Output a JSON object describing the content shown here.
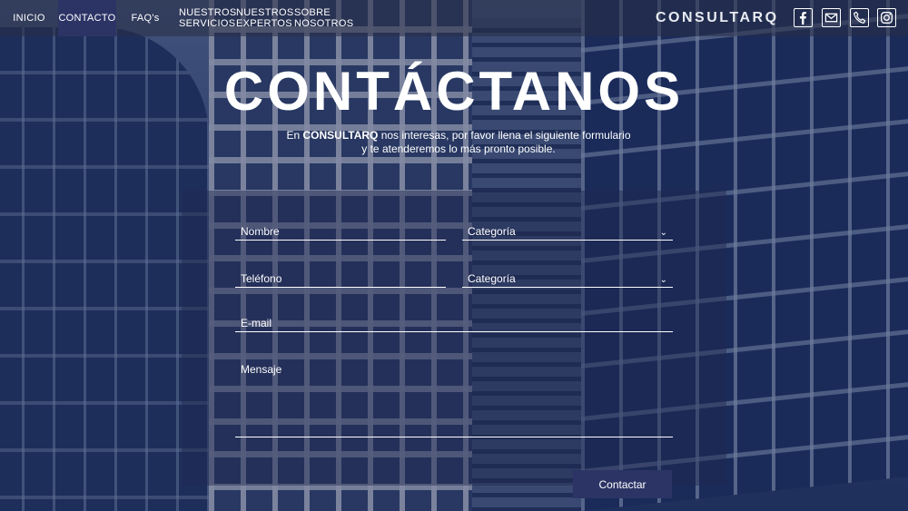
{
  "nav": {
    "items": [
      {
        "label": "INICIO"
      },
      {
        "label": "CONTACTO"
      },
      {
        "label": "FAQ's"
      },
      {
        "line1": "NUESTROS",
        "line2": "SERVICIOS"
      },
      {
        "line1": "NUESTROS",
        "line2": "EXPERTOS"
      },
      {
        "line1": "SOBRE",
        "line2": "NOSOTROS"
      }
    ],
    "active_index": 1,
    "brand": "CONSULTARQ",
    "social_icons": [
      "facebook-icon",
      "mail-icon",
      "phone-icon",
      "instagram-icon"
    ]
  },
  "hero": {
    "title": "CONTÁCTANOS",
    "sub_prefix": "En ",
    "sub_brand": "CONSULTARQ",
    "sub_line1_rest": " nos interesas, por favor llena el siguiente formulario",
    "sub_line2": "y te atenderemos lo más pronto posible."
  },
  "form": {
    "name_placeholder": "Nombre",
    "category1_value": "Categoría",
    "phone_placeholder": "Teléfono",
    "category2_value": "Categoría",
    "email_placeholder": "E-mail",
    "message_placeholder": "Mensaje",
    "submit_label": "Contactar"
  },
  "colors": {
    "accent": "#2c3466",
    "nav_bg": "#282e46",
    "text": "#ffffff"
  }
}
